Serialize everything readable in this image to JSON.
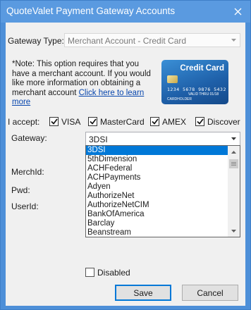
{
  "window": {
    "title": "QuoteValet Payment Gateway Accounts",
    "close_glyph": "✕"
  },
  "gateway_type": {
    "label": "Gateway Type:",
    "value": "Merchant Account - Credit Card"
  },
  "note": {
    "text": "*Note: This option requires that you have a merchant account. If you would like more information on obtaining a merchant account",
    "link": "Click here to learn more"
  },
  "card_image": {
    "title": "Credit Card",
    "number": "1234  5678  9876  5432",
    "expiry": "VALID THRU 01/18",
    "holder": "CARDHOLDER"
  },
  "accept": {
    "label": "I accept:",
    "cards": [
      {
        "label": "VISA",
        "checked": true
      },
      {
        "label": "MasterCard",
        "checked": true
      },
      {
        "label": "AMEX",
        "checked": true
      },
      {
        "label": "Discover",
        "checked": true
      }
    ]
  },
  "gateway": {
    "label": "Gateway:",
    "value": "3DSI",
    "options": [
      "3DSI",
      "5thDimension",
      "ACHFederal",
      "ACHPayments",
      "Adyen",
      "AuthorizeNet",
      "AuthorizeNetCIM",
      "BankOfAmerica",
      "Barclay",
      "Beanstream"
    ],
    "selected_index": 0
  },
  "fields": {
    "merchid_label": "MerchId:",
    "pwd_label": "Pwd:",
    "userid_label": "UserId:"
  },
  "disabled_checkbox": {
    "label": "Disabled",
    "checked": false
  },
  "buttons": {
    "save": "Save",
    "cancel": "Cancel"
  },
  "colors": {
    "title_bar": "#5a9ae0",
    "selection": "#0078d7",
    "link": "#0645ad"
  }
}
